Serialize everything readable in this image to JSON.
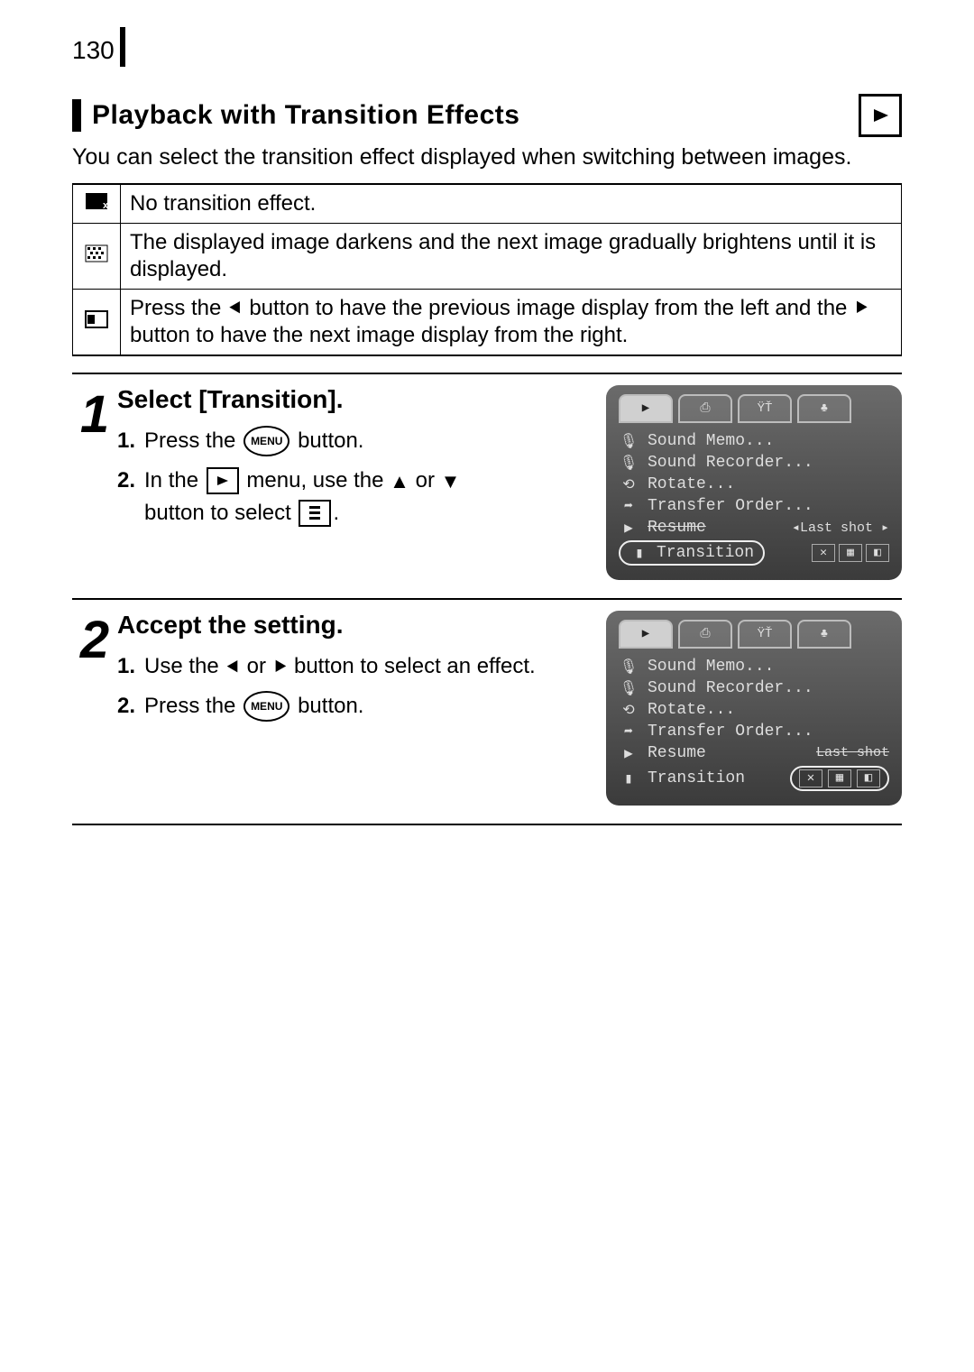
{
  "page_number": "130",
  "section_title": "Playback with Transition Effects",
  "intro": "You can select the transition effect displayed when switching between images.",
  "effects_table": [
    {
      "icon": "none",
      "text": "No transition effect."
    },
    {
      "icon": "fade",
      "text": "The displayed image darkens and the next image gradually brightens until it is displayed."
    },
    {
      "icon": "slide",
      "text_a": "Press the ",
      "text_b": " button to have the previous image display from the left and the ",
      "text_c": " button to have the next image display from the right."
    }
  ],
  "steps": [
    {
      "num": "1",
      "title": "Select [Transition].",
      "sub": [
        {
          "n": "1.",
          "a": "Press the ",
          "b": " button."
        },
        {
          "n": "2.",
          "a": "In the ",
          "b": " menu, use the ",
          "c": " or ",
          "d": " button to select ",
          "e": "."
        }
      ],
      "lcd": {
        "tabs": [
          "▶",
          "⎙",
          "ŸŤ",
          "♣"
        ],
        "active_tab": 0,
        "items": [
          {
            "icon": "🎙",
            "label": "Sound Memo..."
          },
          {
            "icon": "🎙",
            "label": "Sound Recorder..."
          },
          {
            "icon": "⟲",
            "label": "Rotate..."
          },
          {
            "icon": "➦",
            "label": "Transfer Order..."
          },
          {
            "icon": "▶",
            "label": "Resume",
            "strike": true,
            "right": "◂Last shot   ▸"
          }
        ],
        "highlight": {
          "icon": "▮",
          "label": "Transition",
          "opts": [
            "✕",
            "▦",
            "◧"
          ]
        },
        "highlight_row": true
      }
    },
    {
      "num": "2",
      "title": "Accept the setting.",
      "sub": [
        {
          "n": "1.",
          "a": "Use the ",
          "b": " or ",
          "c": " button to select an effect."
        },
        {
          "n": "2.",
          "a": "Press the ",
          "b": " button."
        }
      ],
      "lcd": {
        "tabs": [
          "▶",
          "⎙",
          "ŸŤ",
          "♣"
        ],
        "active_tab": 0,
        "items": [
          {
            "icon": "🎙",
            "label": "Sound Memo..."
          },
          {
            "icon": "🎙",
            "label": "Sound Recorder..."
          },
          {
            "icon": "⟲",
            "label": "Rotate..."
          },
          {
            "icon": "➦",
            "label": "Transfer Order..."
          },
          {
            "icon": "▶",
            "label": "Resume",
            "right": "Last shot",
            "right_strike": true
          }
        ],
        "highlight": {
          "icon": "▮",
          "label": "Transition",
          "opts": [
            "✕",
            "▦",
            "◧"
          ]
        },
        "highlight_opts": true
      }
    }
  ],
  "glyphs": {
    "menu": "MENU",
    "play": "▶",
    "up": "✦",
    "down": "✦",
    "left": "✦",
    "right": "✦"
  }
}
